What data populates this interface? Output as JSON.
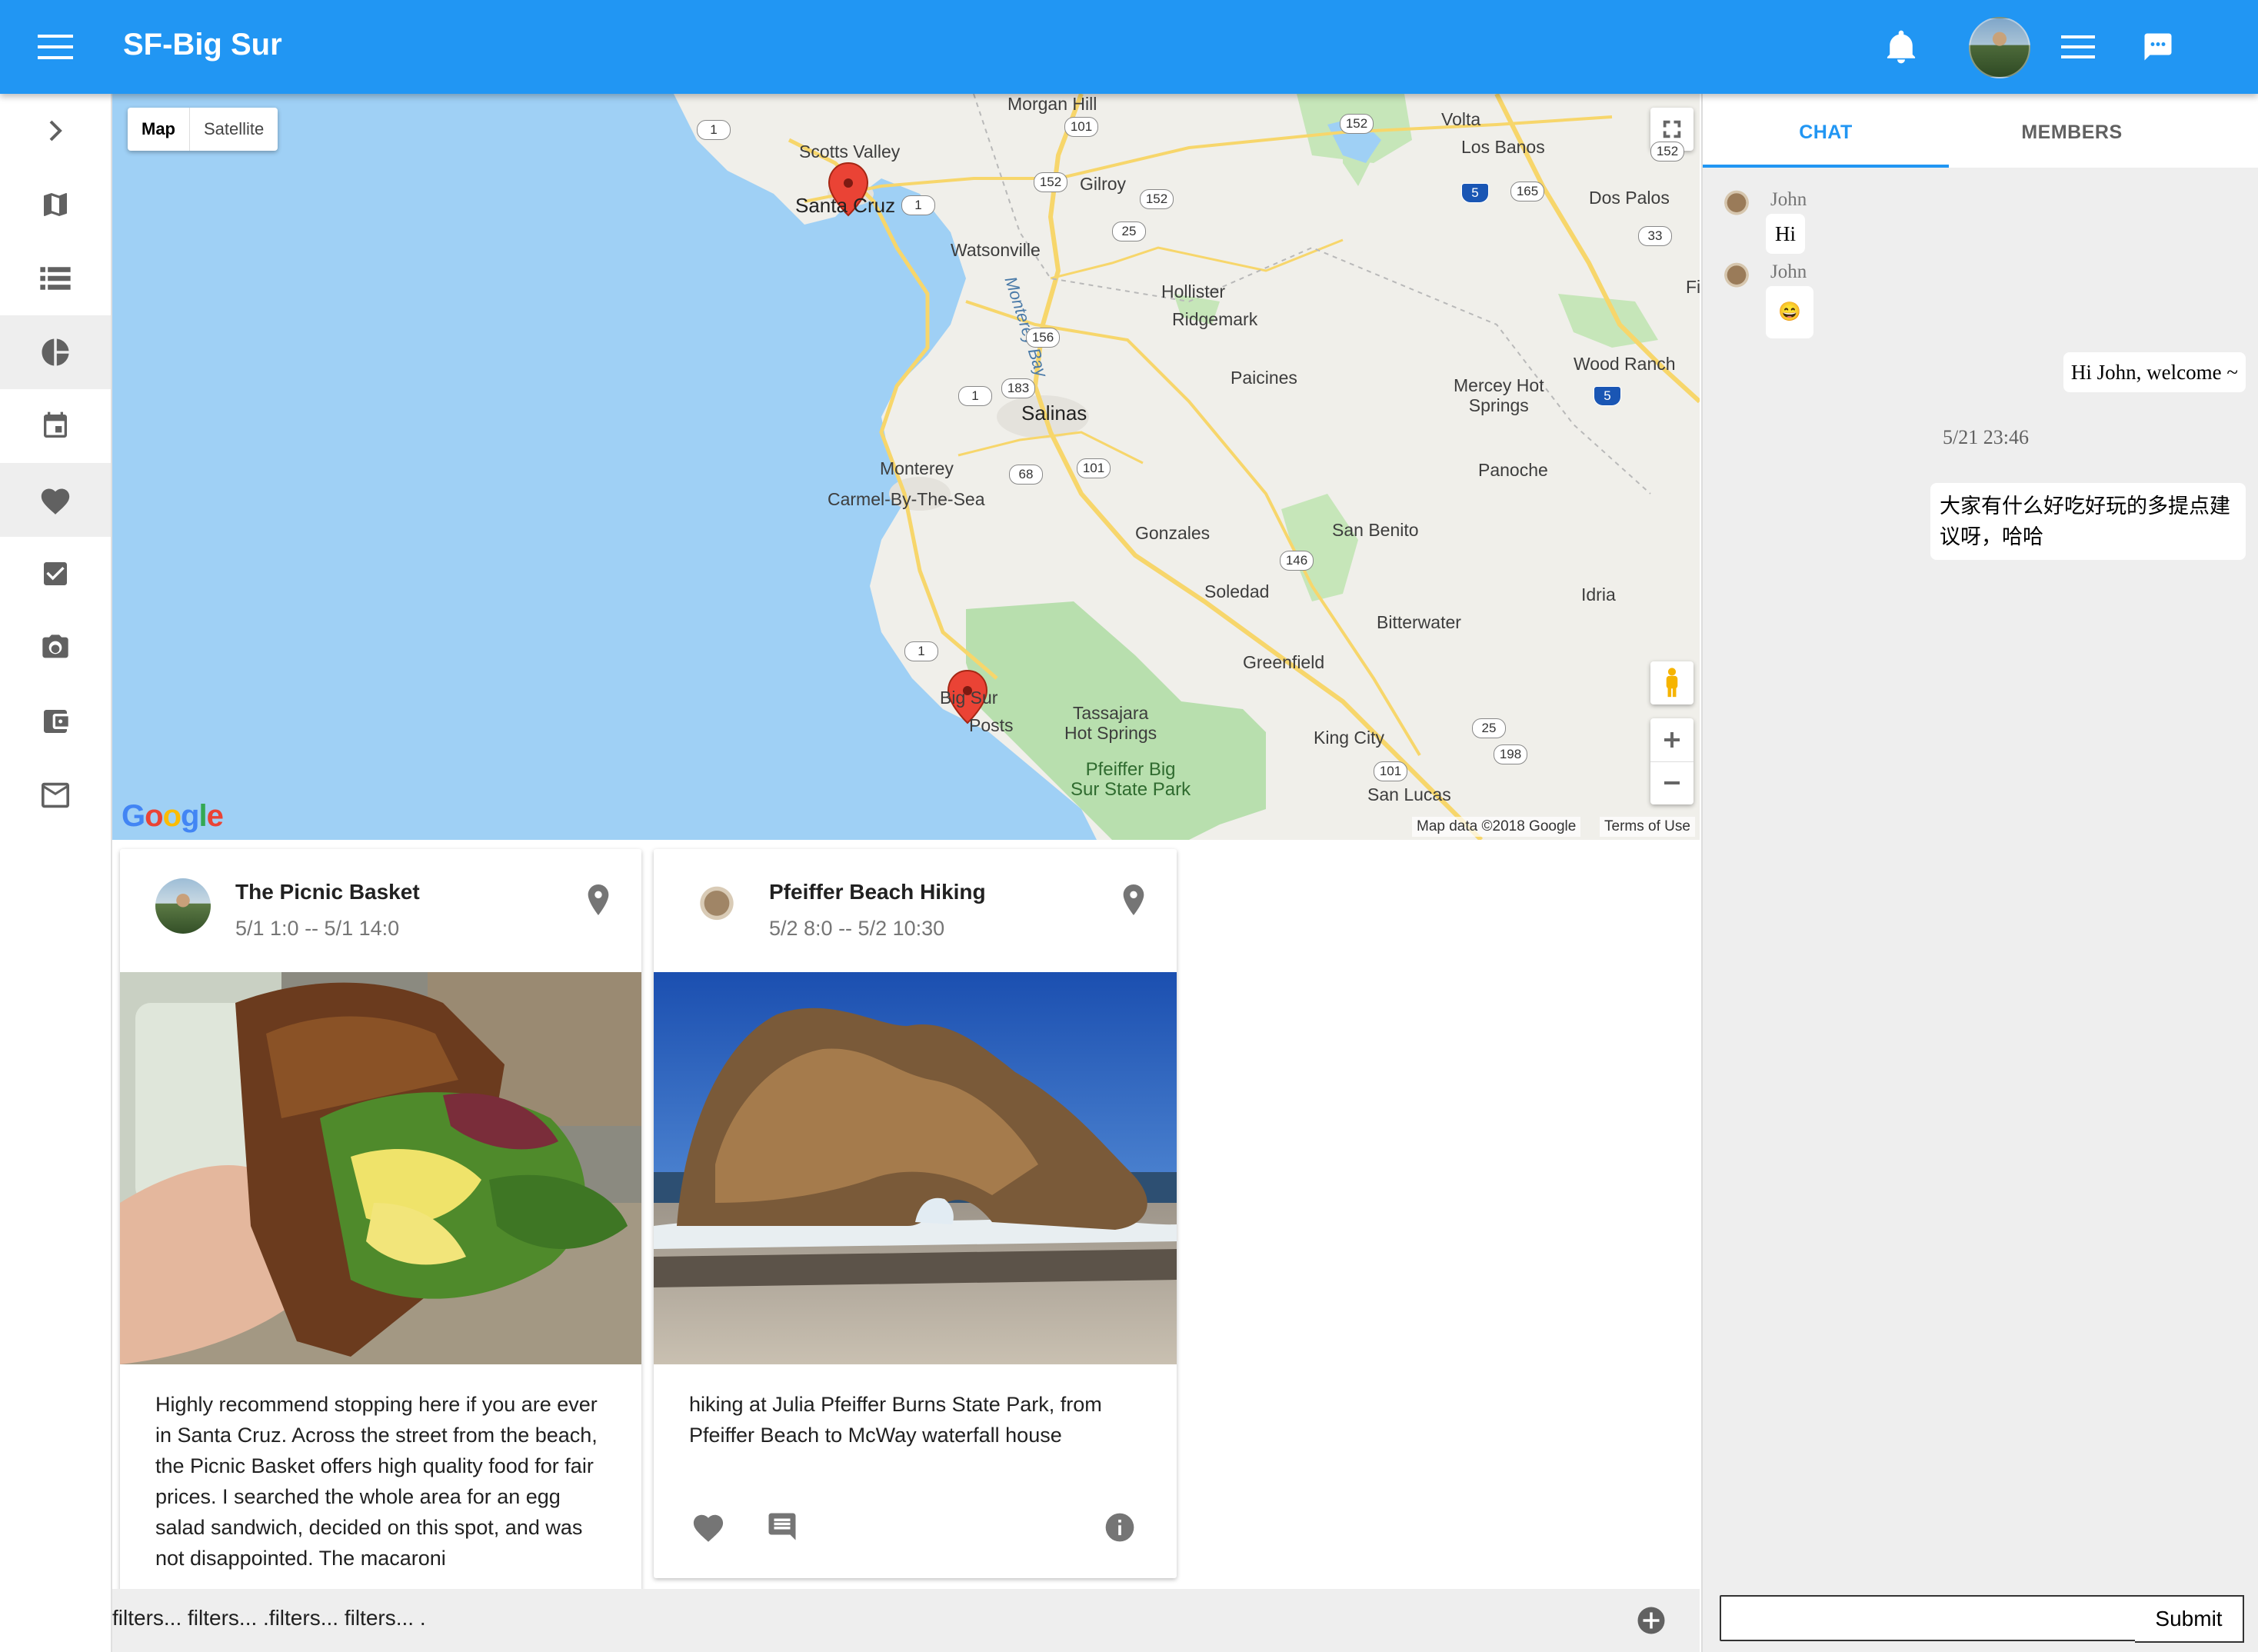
{
  "appbar": {
    "title": "SF-Big Sur",
    "icons": [
      "menu-icon",
      "bell-icon",
      "avatar",
      "list-menu-icon",
      "chat-icon"
    ],
    "color": "#2196f3"
  },
  "sidebar": {
    "items": [
      {
        "icon": "chevron-right-icon"
      },
      {
        "icon": "map-icon"
      },
      {
        "icon": "list-icon"
      },
      {
        "icon": "pie-chart-icon",
        "active": true
      },
      {
        "icon": "calendar-icon"
      },
      {
        "icon": "heart-icon",
        "active": true
      },
      {
        "icon": "checkbox-icon"
      },
      {
        "icon": "camera-icon"
      },
      {
        "icon": "wallet-icon"
      },
      {
        "icon": "mail-icon"
      }
    ]
  },
  "map": {
    "type_map": "Map",
    "type_satellite": "Satellite",
    "logo": "Google",
    "credit": "Map data ©2018 Google",
    "terms": "Terms of Use",
    "places": {
      "morgan_hill": "Morgan Hill",
      "scotts_valley": "Scotts Valley",
      "santa_cruz": "Santa Cruz",
      "gilroy": "Gilroy",
      "watsonville": "Watsonville",
      "hollister": "Hollister",
      "ridgemark": "Ridgemark",
      "monterey_bay": "Monterey Bay",
      "salinas": "Salinas",
      "paicines": "Paicines",
      "monterey": "Monterey",
      "carmel": "Carmel-By-The-Sea",
      "gonzales": "Gonzales",
      "soledad": "Soledad",
      "san_benito": "San Benito",
      "mercey_hot_springs": "Mercey Hot\nSprings",
      "panoche": "Panoche",
      "idria": "Idria",
      "bitterwater": "Bitterwater",
      "greenfield": "Greenfield",
      "big_sur": "Big Sur",
      "posts": "Posts",
      "tassajara": "Tassajara\nHot Springs",
      "pfeiffer_park": "Pfeiffer Big\nSur State Park",
      "king_city": "King City",
      "san_lucas": "San Lucas",
      "volta": "Volta",
      "los_banos": "Los Banos",
      "dos_palos": "Dos Palos",
      "wood_ranch": "Wood Ranch",
      "fi": "Fi"
    },
    "shields": [
      "1",
      "101",
      "152",
      "152",
      "152",
      "1",
      "152",
      "152",
      "25",
      "156",
      "183",
      "1",
      "68",
      "101",
      "146",
      "1",
      "5",
      "165",
      "33",
      "5",
      "25",
      "198",
      "101"
    ]
  },
  "cards": [
    {
      "title": "The Picnic Basket",
      "time": "5/1 1:0 -- 5/1 14:0",
      "text": "Highly recommend stopping here if you are ever in Santa Cruz. Across the street from the beach, the Picnic Basket offers high quality food for fair prices. I searched the whole area for an egg salad sandwich, decided on this spot, and was not disappointed. The macaroni"
    },
    {
      "title": "Pfeiffer Beach Hiking",
      "time": "5/2 8:0 -- 5/2 10:30",
      "text": "hiking at Julia Pfeiffer Burns State Park, from Pfeiffer Beach to McWay waterfall house"
    }
  ],
  "filterbar": {
    "text": "filters... filters... .filters... filters... ."
  },
  "chat": {
    "tabs": [
      "CHAT",
      "MEMBERS"
    ],
    "messages": [
      {
        "name": "John",
        "text": "Hi"
      },
      {
        "name": "John",
        "text": "😄"
      }
    ],
    "own_message_1": "Hi John, welcome ~",
    "timestamp": "5/21 23:46",
    "own_message_2": "大家有什么好吃好玩的多提点建议呀，哈哈",
    "input_value": "",
    "submit_label": "Submit"
  }
}
